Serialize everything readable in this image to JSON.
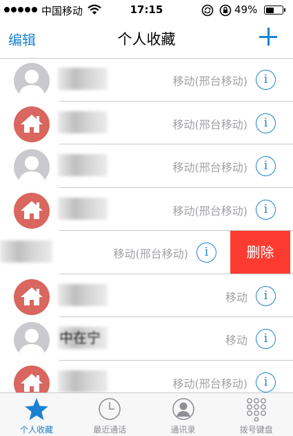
{
  "status_bar": {
    "carrier": "中国移动",
    "time": "17:15",
    "battery": "49%"
  },
  "nav": {
    "edit_label": "编辑",
    "title": "个人收藏",
    "add_icon": "plus-icon"
  },
  "colors": {
    "accent": "#1b82d3",
    "delete": "#fd3b31",
    "home_avatar": "#d9665f",
    "person_avatar": "#c9c9ce"
  },
  "contacts": [
    {
      "avatar": "person",
      "subtitle": "移动(邢台移动)"
    },
    {
      "avatar": "home",
      "subtitle": "移动(邢台移动)"
    },
    {
      "avatar": "person",
      "subtitle": "移动(邢台移动)"
    },
    {
      "avatar": "home",
      "subtitle": "移动(邢台移动)"
    },
    {
      "avatar": "none",
      "subtitle": "移动(邢台移动)",
      "swiped": true,
      "delete_label": "删除"
    },
    {
      "avatar": "home",
      "subtitle": "移动"
    },
    {
      "avatar": "person",
      "subtitle": "移动",
      "name_partial": "中在宁"
    },
    {
      "avatar": "home",
      "subtitle": "移动(邢台移动)"
    }
  ],
  "tabs": [
    {
      "label": "个人收藏",
      "icon": "star-icon",
      "active": true
    },
    {
      "label": "最近通话",
      "icon": "clock-icon",
      "active": false
    },
    {
      "label": "通讯录",
      "icon": "contacts-icon",
      "active": false
    },
    {
      "label": "拨号键盘",
      "icon": "keypad-icon",
      "active": false
    }
  ]
}
